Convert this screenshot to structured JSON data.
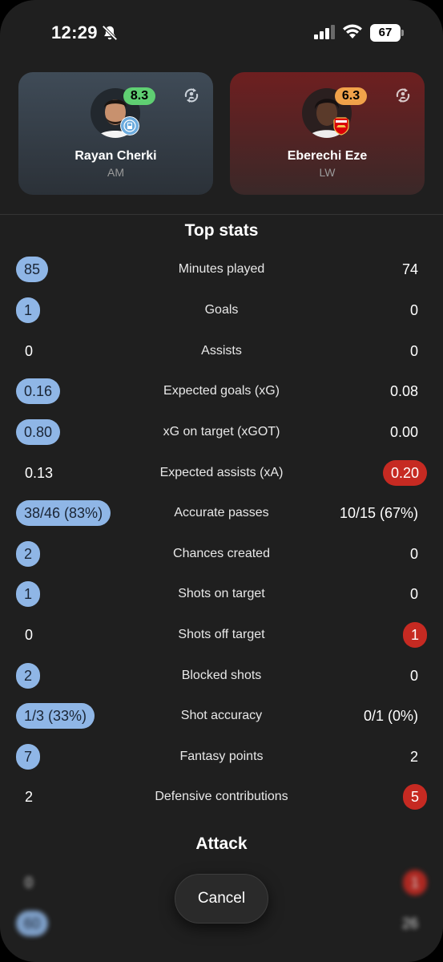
{
  "status_bar": {
    "time": "12:29",
    "battery": "67"
  },
  "players": {
    "left": {
      "name": "Rayan Cherki",
      "position": "AM",
      "rating": "8.3",
      "rating_color": "#5fcf72",
      "club_icon": "manchester-city-crest"
    },
    "right": {
      "name": "Eberechi Eze",
      "position": "LW",
      "rating": "6.3",
      "rating_color": "#f0a24a",
      "club_icon": "arsenal-crest"
    }
  },
  "sections": {
    "top_stats": "Top stats",
    "attack": "Attack"
  },
  "top_stats": [
    {
      "label": "Minutes played",
      "left": "85",
      "right": "74"
    },
    {
      "label": "Goals",
      "left": "1",
      "right": "0"
    },
    {
      "label": "Assists",
      "left": "0",
      "right": "0"
    },
    {
      "label": "Expected goals (xG)",
      "left": "0.16",
      "right": "0.08"
    },
    {
      "label": "xG on target (xGOT)",
      "left": "0.80",
      "right": "0.00"
    },
    {
      "label": "Expected assists (xA)",
      "left": "0.13",
      "right": "0.20"
    },
    {
      "label": "Accurate passes",
      "left": "38/46 (83%)",
      "right": "10/15 (67%)"
    },
    {
      "label": "Chances created",
      "left": "2",
      "right": "0"
    },
    {
      "label": "Shots on target",
      "left": "1",
      "right": "0"
    },
    {
      "label": "Shots off target",
      "left": "0",
      "right": "1"
    },
    {
      "label": "Blocked shots",
      "left": "2",
      "right": "0"
    },
    {
      "label": "Shot accuracy",
      "left": "1/3 (33%)",
      "right": "0/1 (0%)"
    },
    {
      "label": "Fantasy points",
      "left": "7",
      "right": "2"
    },
    {
      "label": "Defensive contributions",
      "left": "2",
      "right": "5"
    }
  ],
  "attack_rows": [
    {
      "left": "0",
      "right": "1"
    },
    {
      "left": "60",
      "right": "26"
    }
  ],
  "cancel_label": "Cancel",
  "colors": {
    "leader_pill": "#8fb6e6",
    "leader_pill_red": "#c62a22",
    "background": "#1f1f1f"
  }
}
